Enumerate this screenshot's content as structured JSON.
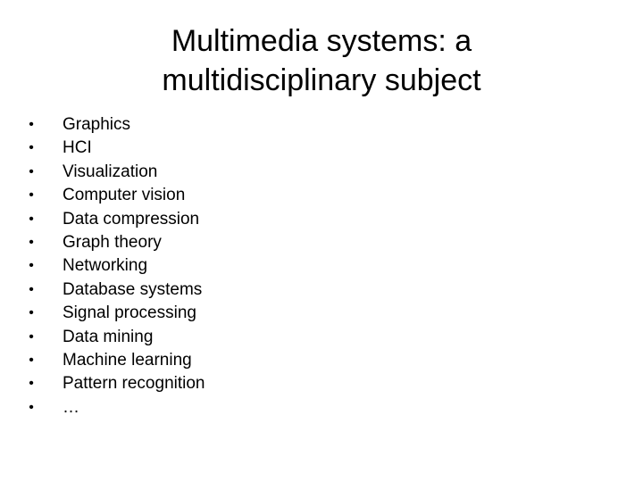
{
  "slide": {
    "title_lines": [
      "Multimedia systems: a",
      "multidisciplinary subject"
    ],
    "bullet_glyph": "•",
    "items": [
      "Graphics",
      "HCI",
      "Visualization",
      "Computer vision",
      "Data compression",
      "Graph theory",
      "Networking",
      "Database systems",
      "Signal processing",
      "Data mining",
      "Machine learning",
      "Pattern recognition",
      "…"
    ]
  }
}
